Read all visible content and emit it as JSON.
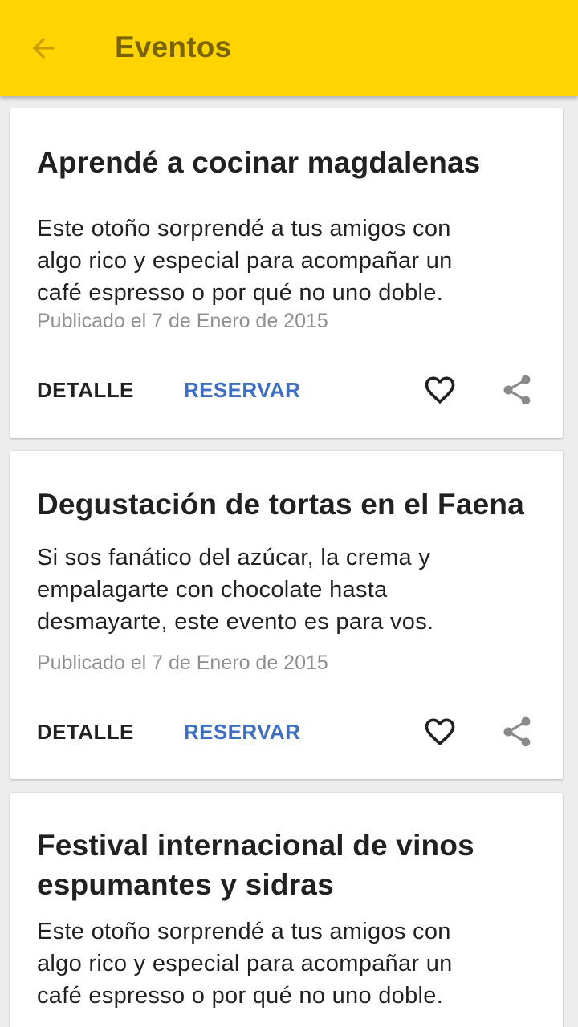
{
  "appbar": {
    "title": "Eventos",
    "back_icon": "arrow-back-icon"
  },
  "colors": {
    "appbar": "#ffd400",
    "title_text": "#7a6400",
    "accent": "#3e6fc0",
    "date_text": "#8f8f8f"
  },
  "events": [
    {
      "title": "Aprendé a cocinar magdalenas",
      "desc_lines": [
        "Este otoño sorprendé a tus amigos con",
        "algo rico y especial para acompañar un",
        "café espresso o por qué no uno doble."
      ],
      "date": "Publicado el 7 de Enero de 2015",
      "detail_label": "DETALLE",
      "reserve_label": "RESERVAR"
    },
    {
      "title": "Degustación de tortas en el Faena",
      "desc_lines": [
        "Si sos fanático del azúcar, la crema y",
        "empalagarte con chocolate hasta",
        "desmayarte, este evento es para vos."
      ],
      "date": "Publicado el 7 de Enero de 2015",
      "detail_label": "DETALLE",
      "reserve_label": "RESERVAR"
    },
    {
      "title_lines": [
        "Festival internacional de vinos",
        "espumantes y sidras"
      ],
      "desc_lines": [
        "Este otoño sorprendé a tus amigos con",
        "algo rico y especial para acompañar un",
        "café espresso o por qué no uno doble."
      ]
    }
  ]
}
